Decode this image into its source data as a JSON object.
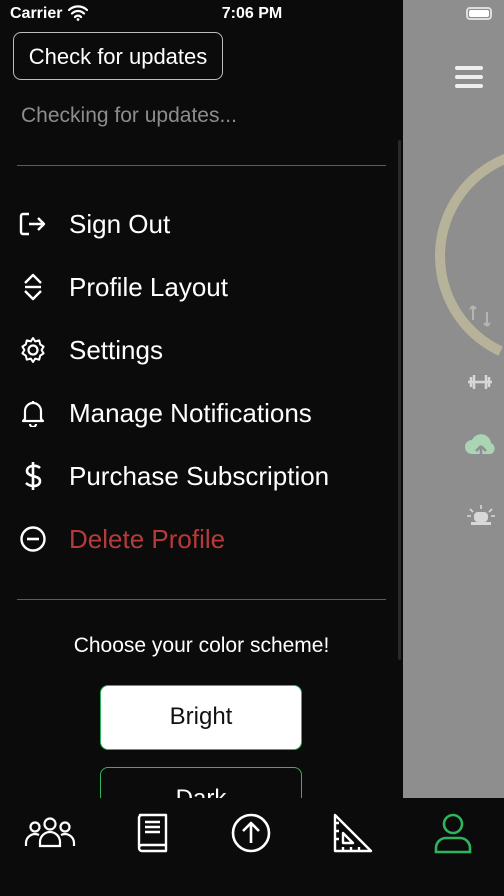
{
  "status_bar": {
    "carrier": "Carrier",
    "time": "7:06 PM"
  },
  "drawer": {
    "update_button": "Check for updates",
    "update_status": "Checking for updates...",
    "menu": [
      {
        "label": "Sign Out",
        "icon": "sign-out-icon"
      },
      {
        "label": "Profile Layout",
        "icon": "sort-arrows-icon"
      },
      {
        "label": "Settings",
        "icon": "gear-icon"
      },
      {
        "label": "Manage Notifications",
        "icon": "bell-icon"
      },
      {
        "label": "Purchase Subscription",
        "icon": "dollar-icon"
      },
      {
        "label": "Delete Profile",
        "icon": "minus-circle-icon"
      }
    ],
    "color_scheme": {
      "title": "Choose your color scheme!",
      "options": [
        "Bright",
        "Dark"
      ],
      "selected": "Bright"
    }
  },
  "tabbar": {
    "tabs": [
      {
        "icon": "group-icon"
      },
      {
        "icon": "book-icon"
      },
      {
        "icon": "upload-circle-icon"
      },
      {
        "icon": "triangle-ruler-icon"
      },
      {
        "icon": "user-icon",
        "active": true
      }
    ]
  },
  "colors": {
    "accent": "#2db55d",
    "danger": "#b63a3a",
    "background": "#0b0b0b",
    "dim_overlay": "#8e8e8e"
  }
}
